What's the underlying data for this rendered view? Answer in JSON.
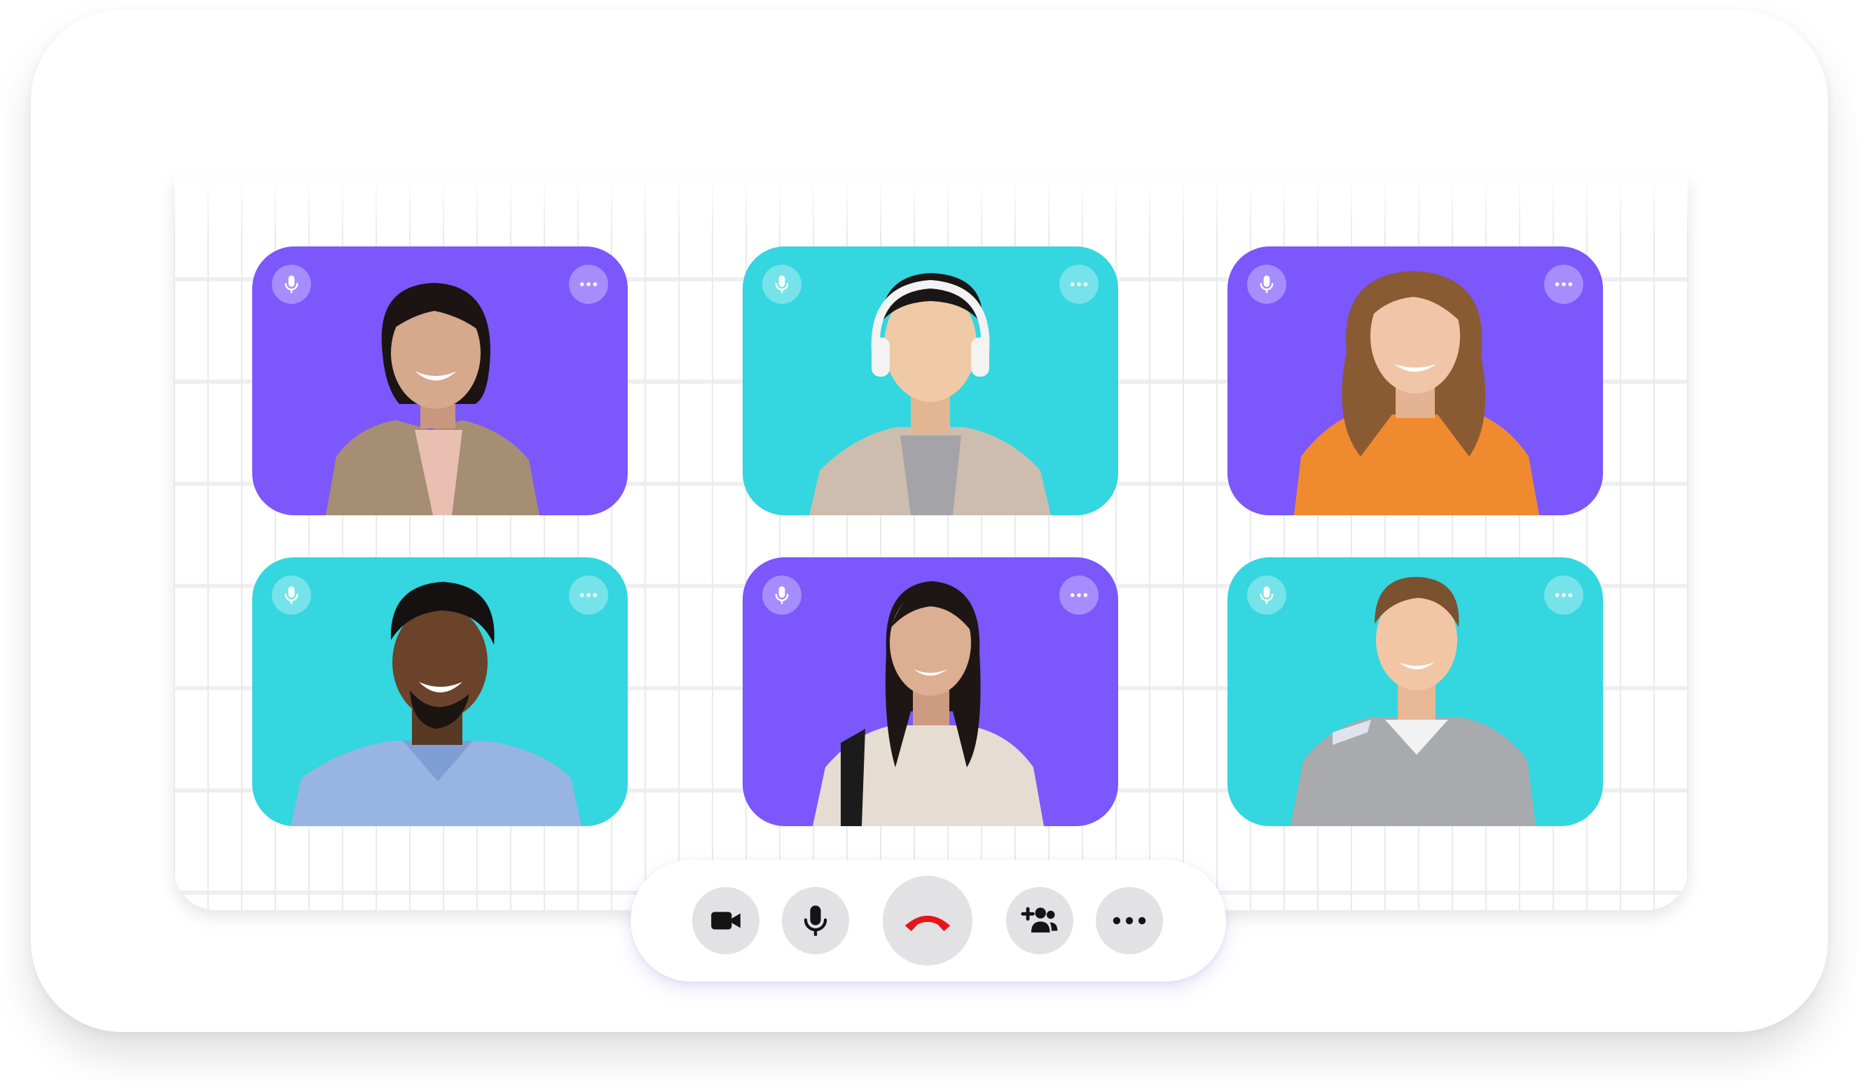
{
  "call": {
    "participants": [
      {
        "tile_color": "#7b57fc",
        "mic_icon": "microphone-icon",
        "menu_icon": "ellipsis-icon"
      },
      {
        "tile_color": "#34d6df",
        "mic_icon": "microphone-icon",
        "menu_icon": "ellipsis-icon"
      },
      {
        "tile_color": "#7b57fc",
        "mic_icon": "microphone-icon",
        "menu_icon": "ellipsis-icon"
      },
      {
        "tile_color": "#34d6df",
        "mic_icon": "microphone-icon",
        "menu_icon": "ellipsis-icon"
      },
      {
        "tile_color": "#7b57fc",
        "mic_icon": "microphone-icon",
        "menu_icon": "ellipsis-icon"
      },
      {
        "tile_color": "#34d6df",
        "mic_icon": "microphone-icon",
        "menu_icon": "ellipsis-icon"
      }
    ]
  },
  "toolbar": {
    "buttons": [
      {
        "icon": "video-camera-icon"
      },
      {
        "icon": "microphone-icon"
      },
      {
        "icon": "end-call-icon",
        "color": "#e8141b"
      },
      {
        "icon": "add-participant-icon"
      },
      {
        "icon": "more-options-icon"
      }
    ]
  },
  "colors": {
    "purple": "#7b57fc",
    "cyan": "#34d6df",
    "end_call_red": "#e8141b",
    "button_gray": "#e2e2e5"
  }
}
